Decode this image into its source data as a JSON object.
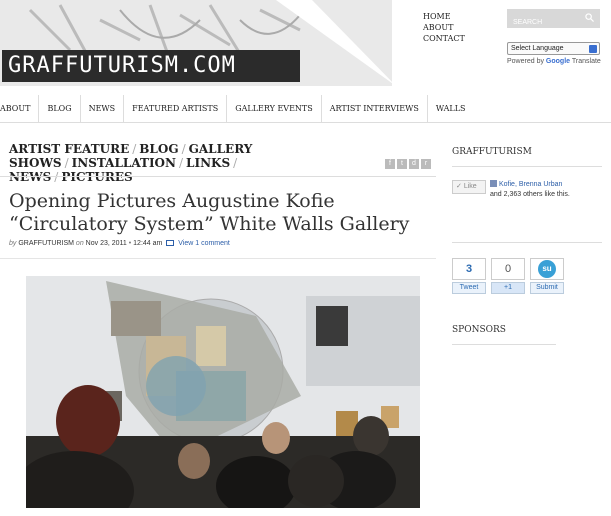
{
  "header": {
    "logo": "GRAFFUTURISM.COM",
    "top_links": [
      "HOME",
      "ABOUT",
      "CONTACT"
    ],
    "search_placeholder": "SEARCH",
    "language_select": "Select Language",
    "powered_prefix": "Powered by",
    "powered_brand": "Google",
    "powered_suffix": "Translate"
  },
  "nav": [
    "ABOUT",
    "BLOG",
    "NEWS",
    "FEATURED ARTISTS",
    "GALLERY EVENTS",
    "ARTIST INTERVIEWS",
    "WALLS"
  ],
  "categories": [
    "ARTIST FEATURE",
    "BLOG",
    "GALLERY SHOWS",
    "INSTALLATION",
    "LINKS",
    "NEWS",
    "PICTURES"
  ],
  "share_icons": [
    "facebook-icon",
    "twitter-icon",
    "digg-icon",
    "rss-icon"
  ],
  "post": {
    "title": "Opening Pictures Augustine Kofie “Circulatory System” White Walls Gallery",
    "by_label": "by",
    "author": "GRAFFUTURISM",
    "on_label": "on",
    "date": "Nov 23, 2011",
    "separator": "•",
    "time": "12:44 am",
    "comments": "View 1 comment"
  },
  "sidebar": {
    "heading": "GRAFFUTURISM",
    "like_label": "Like",
    "like_names": "Kofie, Brenna Urban",
    "like_others": "and 2,363 others like this.",
    "tweet_count": "3",
    "tweet_label": "Tweet",
    "plus_count": "0",
    "plus_label": "+1",
    "su_logo": "su",
    "submit_label": "Submit",
    "sponsors_heading": "SPONSORS"
  }
}
